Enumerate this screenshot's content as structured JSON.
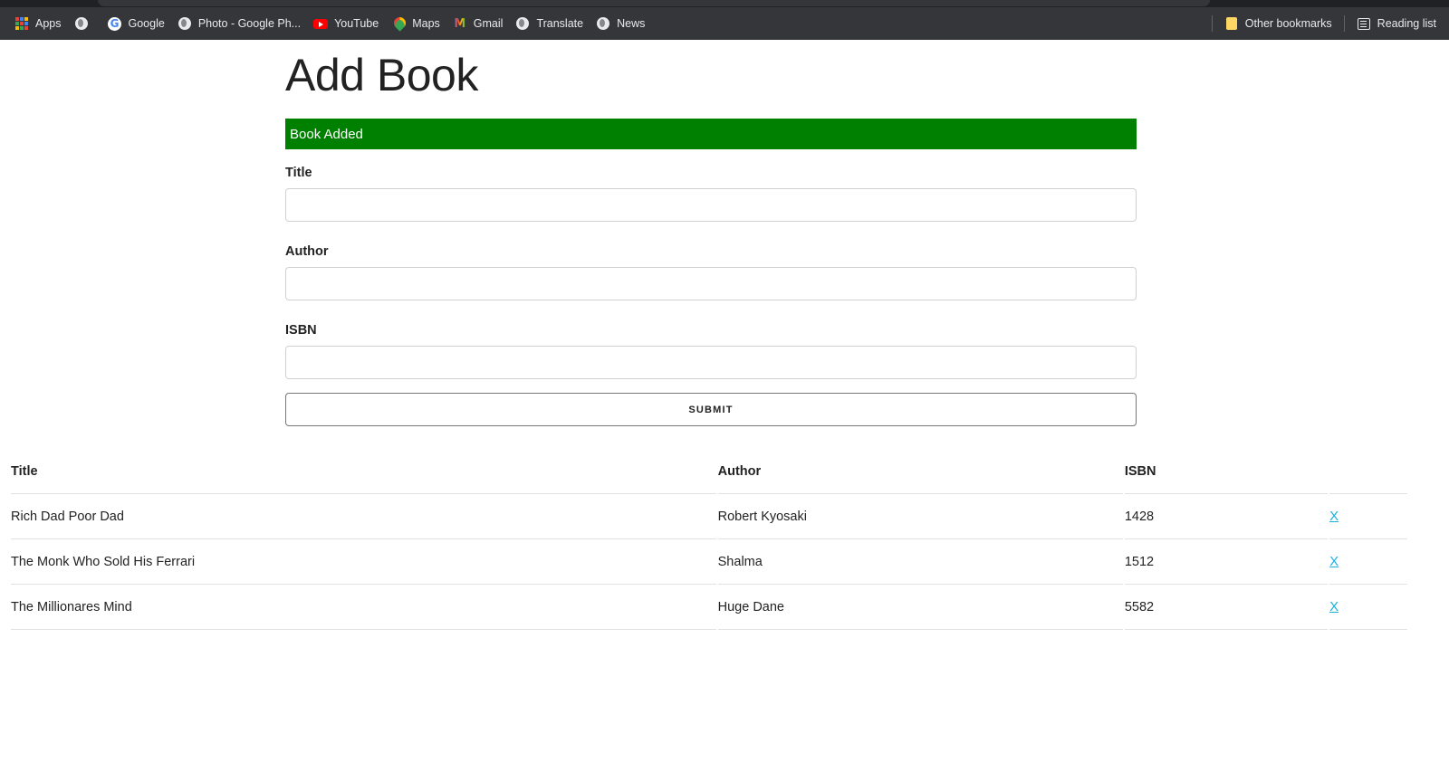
{
  "bookmarks": {
    "items": [
      {
        "label": "Apps",
        "icon": "apps-grid-icon"
      },
      {
        "label": "",
        "icon": "globe-icon"
      },
      {
        "label": "Google",
        "icon": "google-icon"
      },
      {
        "label": "Photo - Google Ph...",
        "icon": "globe-icon"
      },
      {
        "label": "YouTube",
        "icon": "youtube-icon"
      },
      {
        "label": "Maps",
        "icon": "maps-pin-icon"
      },
      {
        "label": "Gmail",
        "icon": "gmail-icon"
      },
      {
        "label": "Translate",
        "icon": "globe-icon"
      },
      {
        "label": "News",
        "icon": "globe-icon"
      }
    ],
    "other_bookmarks": "Other bookmarks",
    "reading_list": "Reading list"
  },
  "page": {
    "heading": "Add Book",
    "alert": {
      "text": "Book Added",
      "color": "#008000"
    },
    "form": {
      "title_label": "Title",
      "title_value": "",
      "author_label": "Author",
      "author_value": "",
      "isbn_label": "ISBN",
      "isbn_value": "",
      "submit_label": "SUBMIT"
    },
    "table": {
      "headers": [
        "Title",
        "Author",
        "ISBN",
        ""
      ],
      "rows": [
        {
          "title": "Rich Dad Poor Dad",
          "author": "Robert Kyosaki",
          "isbn": "1428",
          "delete": "X"
        },
        {
          "title": "The Monk Who Sold His Ferrari",
          "author": "Shalma",
          "isbn": "1512",
          "delete": "X"
        },
        {
          "title": "The Millionares Mind",
          "author": "Huge Dane",
          "isbn": "5582",
          "delete": "X"
        }
      ]
    }
  },
  "colors": {
    "chrome_bg": "#35363a",
    "alert_success": "#008000",
    "link": "#1eaedb"
  }
}
